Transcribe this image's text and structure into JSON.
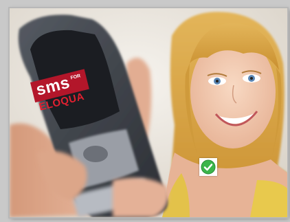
{
  "photo": {
    "logo": {
      "sms_text": "sms",
      "for_text": "FOR",
      "eloqua_text": "ELOQUA",
      "brand_color": "#b3162a"
    },
    "badge_icon": "check-circle-icon",
    "badge_color": "#3bb54a"
  }
}
